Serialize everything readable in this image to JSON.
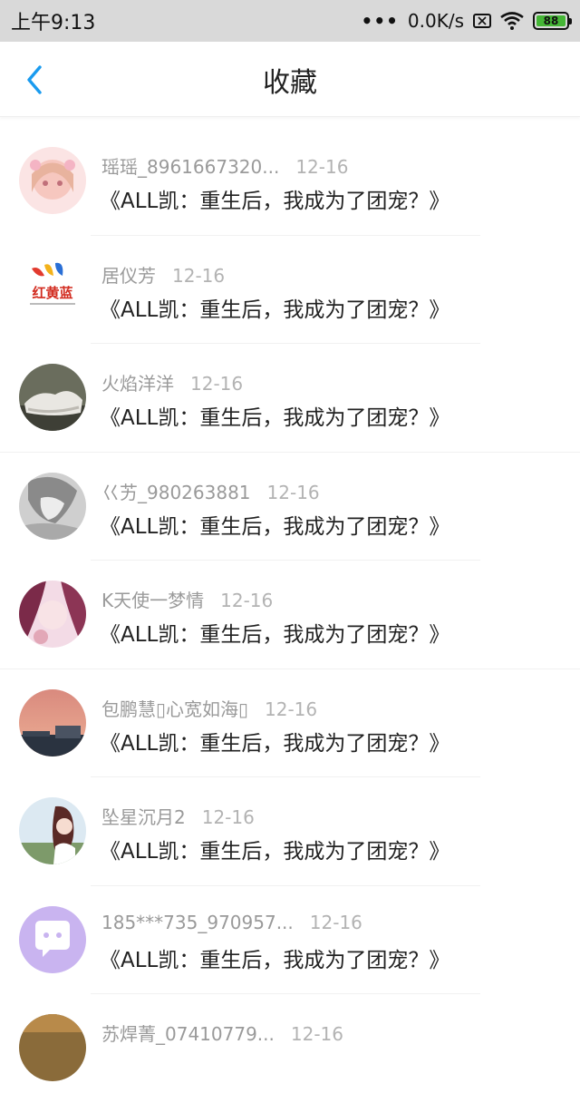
{
  "status_bar": {
    "time": "上午9:13",
    "dots": "•••",
    "network_speed": "0.0K/s",
    "battery_level": "88"
  },
  "header": {
    "title": "收藏"
  },
  "items": [
    {
      "user": "瑶瑶_8961667320...",
      "date": "12-16",
      "title": "《ALL凯：重生后，我成为了团宠？》"
    },
    {
      "user": "居仪芳",
      "date": "12-16",
      "title": "《ALL凯：重生后，我成为了团宠？》"
    },
    {
      "user": "火焰洋洋",
      "date": "12-16",
      "title": "《ALL凯：重生后，我成为了团宠？》"
    },
    {
      "user": "巜艻_980263881",
      "date": "12-16",
      "title": "《ALL凯：重生后，我成为了团宠？》"
    },
    {
      "user": "K天使一梦情",
      "date": "12-16",
      "title": "《ALL凯：重生后，我成为了团宠？》"
    },
    {
      "user": "包鹏慧▯心宽如海▯",
      "date": "12-16",
      "title": "《ALL凯：重生后，我成为了团宠？》"
    },
    {
      "user": "坠星沉月2",
      "date": "12-16",
      "title": "《ALL凯：重生后，我成为了团宠？》"
    },
    {
      "user": "185***735_970957...",
      "date": "12-16",
      "title": "《ALL凯：重生后，我成为了团宠？》"
    },
    {
      "user": "苏焊菁_07410779...",
      "date": "12-16",
      "title": ""
    }
  ],
  "logo_text": "红黄蓝",
  "colors": {
    "accent_blue": "#1a9bef",
    "battery_green": "#45b636"
  }
}
